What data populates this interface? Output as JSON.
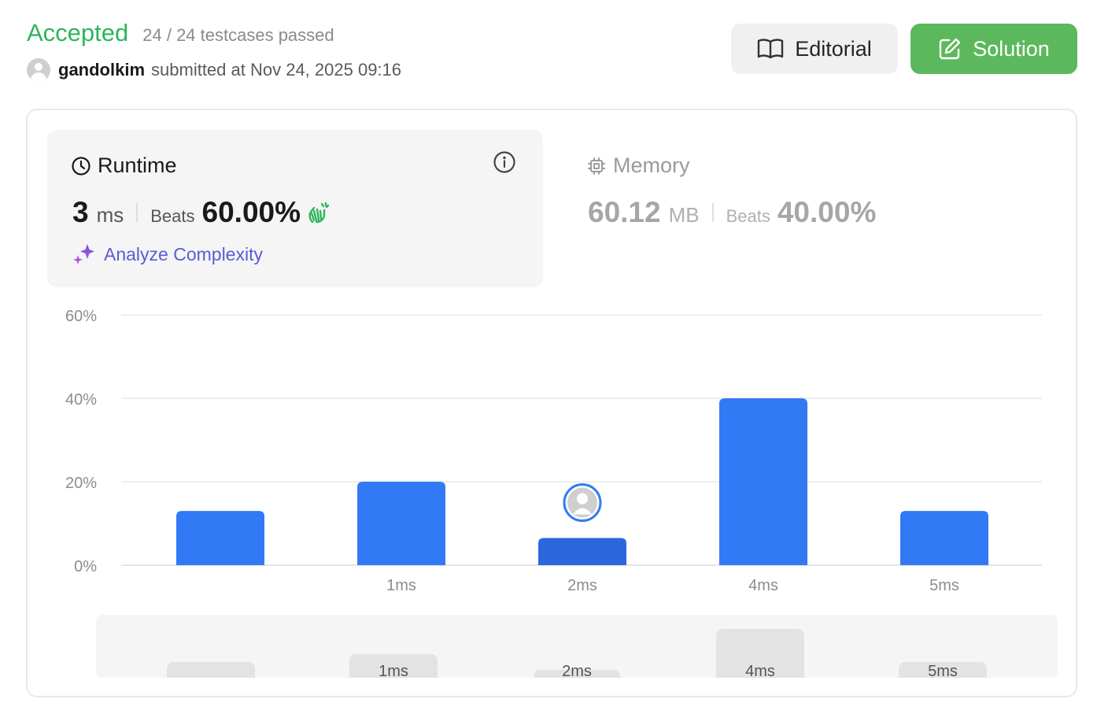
{
  "header": {
    "status": "Accepted",
    "testcases": "24 / 24 testcases passed",
    "username": "gandolkim",
    "submitted": "submitted at Nov 24, 2025 09:16"
  },
  "buttons": {
    "editorial": "Editorial",
    "solution": "Solution"
  },
  "runtime": {
    "title": "Runtime",
    "value": "3",
    "unit": "ms",
    "beats_label": "Beats",
    "beats_pct": "60.00%",
    "analyze": "Analyze Complexity"
  },
  "memory": {
    "title": "Memory",
    "value": "60.12",
    "unit": "MB",
    "beats_label": "Beats",
    "beats_pct": "40.00%"
  },
  "colors": {
    "accepted": "#2db55d",
    "bar": "#3279f5",
    "bar_selected": "#2c66dc",
    "solution_button": "#5cb85c",
    "analyze": "#5b5bd6"
  },
  "chart_data": {
    "type": "bar",
    "categories": [
      "",
      "1ms",
      "2ms",
      "4ms",
      "5ms"
    ],
    "values": [
      13,
      20,
      6.5,
      40,
      13
    ],
    "selected_index": 2,
    "ylim": [
      0,
      60
    ],
    "yticks": [
      "0%",
      "20%",
      "40%",
      "60%"
    ],
    "ytick_values": [
      0,
      20,
      40,
      60
    ],
    "grid": true,
    "overview_labels": [
      "",
      "1ms",
      "2ms",
      "4ms",
      "5ms"
    ]
  }
}
